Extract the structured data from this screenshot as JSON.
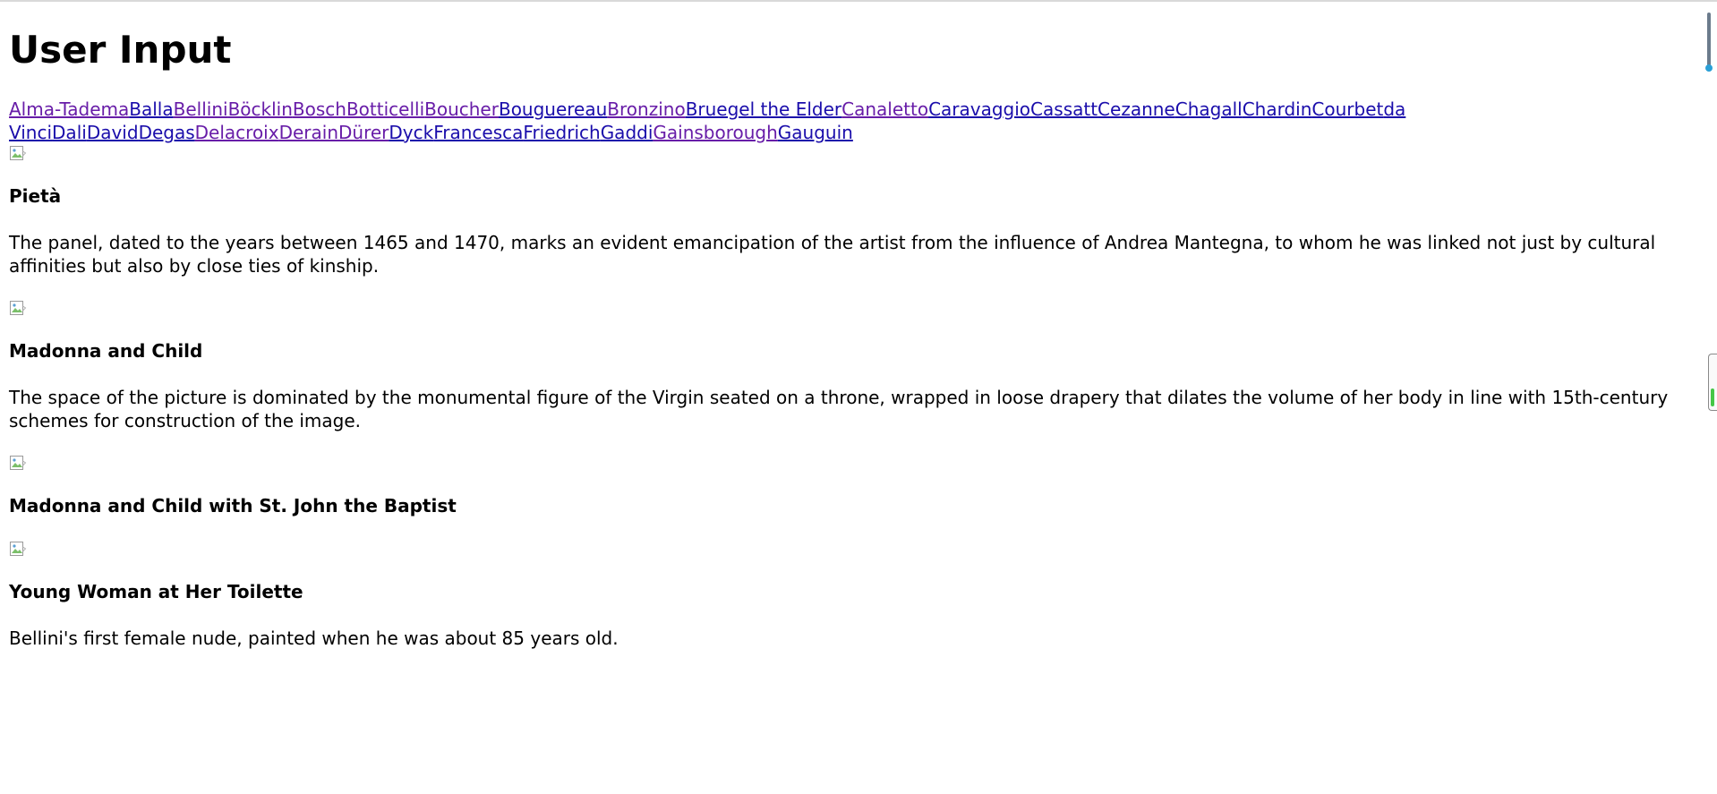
{
  "page": {
    "title": "User Input"
  },
  "artists": [
    {
      "label": "Alma-Tadema",
      "visited": true
    },
    {
      "label": "Balla",
      "visited": false
    },
    {
      "label": "Bellini",
      "visited": true
    },
    {
      "label": "Böcklin",
      "visited": true
    },
    {
      "label": "Bosch",
      "visited": true
    },
    {
      "label": "Botticelli",
      "visited": true
    },
    {
      "label": "Boucher",
      "visited": true
    },
    {
      "label": "Bouguereau",
      "visited": false
    },
    {
      "label": "Bronzino",
      "visited": true
    },
    {
      "label": "Bruegel the Elder",
      "visited": false
    },
    {
      "label": "Canaletto",
      "visited": true
    },
    {
      "label": "Caravaggio",
      "visited": false
    },
    {
      "label": "Cassatt",
      "visited": false
    },
    {
      "label": "Cezanne",
      "visited": false
    },
    {
      "label": "Chagall",
      "visited": false
    },
    {
      "label": "Chardin",
      "visited": false
    },
    {
      "label": "Courbet",
      "visited": false
    },
    {
      "label": "da Vinci",
      "visited": false
    },
    {
      "label": "Dali",
      "visited": false
    },
    {
      "label": "David",
      "visited": false
    },
    {
      "label": "Degas",
      "visited": false
    },
    {
      "label": "Delacroix",
      "visited": true
    },
    {
      "label": "Derain",
      "visited": true
    },
    {
      "label": "Dürer",
      "visited": true
    },
    {
      "label": "Dyck",
      "visited": false
    },
    {
      "label": "Francesca",
      "visited": false
    },
    {
      "label": "Friedrich",
      "visited": false
    },
    {
      "label": "Gaddi",
      "visited": false
    },
    {
      "label": "Gainsborough",
      "visited": true
    },
    {
      "label": "Gauguin",
      "visited": false
    }
  ],
  "entries": [
    {
      "title": "Pietà",
      "description": "The panel, dated to the years between 1465 and 1470, marks an evident emancipation of the artist from the influence of Andrea Mantegna, to whom he was linked not just by cultural affinities but also by close ties of kinship."
    },
    {
      "title": "Madonna and Child",
      "description": "The space of the picture is dominated by the monumental figure of the Virgin seated on a throne, wrapped in loose drapery that dilates the volume of her body in line with 15th-century schemes for construction of the image."
    },
    {
      "title": "Madonna and Child with St. John the Baptist",
      "description": ""
    },
    {
      "title": "Young Woman at Her Toilette",
      "description": "Bellini's first female nude, painted when he was about 85 years old."
    }
  ],
  "colors": {
    "link": "#1a0dab",
    "visited": "#681da8",
    "thermo_bulb": "#2a9fd6",
    "slider_fill": "#46c646"
  },
  "icons": {
    "broken_image": "broken-image-icon",
    "thermometer": "thermometer-icon"
  }
}
